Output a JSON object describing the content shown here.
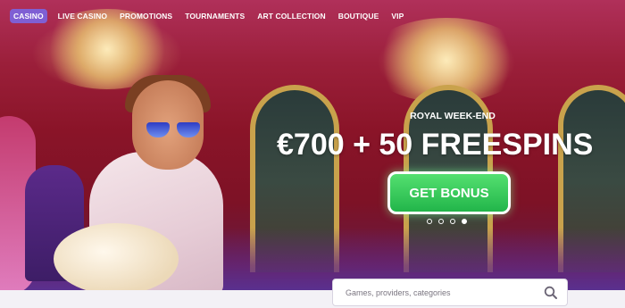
{
  "nav": {
    "items": [
      {
        "label": "CASINO",
        "active": true
      },
      {
        "label": "LIVE CASINO",
        "active": false
      },
      {
        "label": "PROMOTIONS",
        "active": false
      },
      {
        "label": "TOURNAMENTS",
        "active": false
      },
      {
        "label": "ART COLLECTION",
        "active": false
      },
      {
        "label": "BOUTIQUE",
        "active": false
      },
      {
        "label": "VIP",
        "active": false
      }
    ]
  },
  "promo": {
    "subtitle": "ROYAL WEEK-END",
    "title": "€700 + 50 FREESPINS",
    "cta_label": "GET BONUS",
    "slides_total": 4,
    "active_slide": 4
  },
  "search": {
    "placeholder": "Games, providers, categories",
    "value": "",
    "icon": "search-icon"
  },
  "colors": {
    "nav_active_bg": "#7f5fd4",
    "cta_green": "#2ec655",
    "hero_red": "#8a1428"
  }
}
